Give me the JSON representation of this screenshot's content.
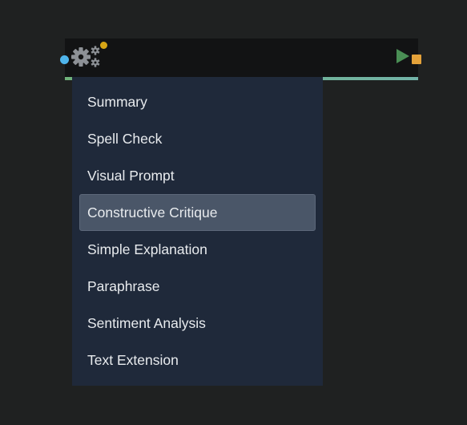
{
  "node": {
    "icon": "gears-icon",
    "status_color": "#d7a515",
    "input_port_color": "#4fb5ec",
    "output_port_color": "#e4a23a",
    "run_icon": "play-icon"
  },
  "menu": {
    "items": [
      {
        "label": "Summary"
      },
      {
        "label": "Spell Check"
      },
      {
        "label": "Visual Prompt"
      },
      {
        "label": "Constructive Critique"
      },
      {
        "label": "Simple Explanation"
      },
      {
        "label": "Paraphrase"
      },
      {
        "label": "Sentiment Analysis"
      },
      {
        "label": "Text Extension"
      }
    ],
    "highlighted_index": 3
  }
}
